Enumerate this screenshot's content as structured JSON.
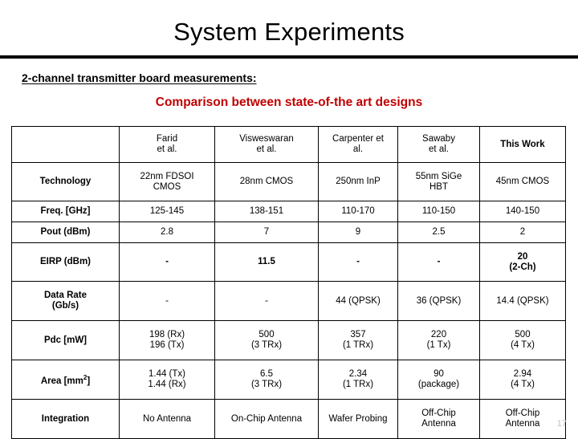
{
  "slide": {
    "title": "System Experiments",
    "subheading": "2-channel transmitter board measurements:",
    "comparison_caption": "Comparison between state-of-the art designs",
    "page_number": "17",
    "accent_red": "#C00000",
    "text_black": "#000000",
    "page_number_color": "#BFBFBF"
  },
  "table": {
    "corner_label": "",
    "columns": [
      {
        "line1": "Farid",
        "line2": "et  al.",
        "strong": false
      },
      {
        "line1": "Visweswaran",
        "line2": "et al.",
        "strong": false
      },
      {
        "line1": "Carpenter et",
        "line2": "al.",
        "strong": false
      },
      {
        "line1": "Sawaby",
        "line2": "et al.",
        "strong": false
      },
      {
        "line1": "This Work",
        "line2": "",
        "strong": true
      }
    ],
    "rows": [
      {
        "label": "Technology",
        "label_sup": "",
        "red": false,
        "cells": [
          {
            "line1": "22nm FDSOI",
            "line2": "CMOS"
          },
          {
            "line1": "28nm CMOS",
            "line2": ""
          },
          {
            "line1": "250nm InP",
            "line2": ""
          },
          {
            "line1": "55nm SiGe",
            "line2": "HBT"
          },
          {
            "line1": "45nm CMOS",
            "line2": ""
          }
        ]
      },
      {
        "label": "Freq. [GHz]",
        "label_sup": "",
        "red": false,
        "cells": [
          {
            "line1": "125-145",
            "line2": ""
          },
          {
            "line1": "138-151",
            "line2": ""
          },
          {
            "line1": "110-170",
            "line2": ""
          },
          {
            "line1": "110-150",
            "line2": ""
          },
          {
            "line1": "140-150",
            "line2": ""
          }
        ]
      },
      {
        "label": "Pout (dBm)",
        "label_sup": "",
        "red": false,
        "cells": [
          {
            "line1": "2.8",
            "line2": ""
          },
          {
            "line1": "7",
            "line2": ""
          },
          {
            "line1": "9",
            "line2": ""
          },
          {
            "line1": "2.5",
            "line2": ""
          },
          {
            "line1": "2",
            "line2": ""
          }
        ]
      },
      {
        "label": "EIRP (dBm)",
        "label_sup": "",
        "red": true,
        "cells": [
          {
            "line1": "-",
            "line2": ""
          },
          {
            "line1": "11.5",
            "line2": ""
          },
          {
            "line1": "-",
            "line2": ""
          },
          {
            "line1": "-",
            "line2": ""
          },
          {
            "line1": "20",
            "line2": "(2-Ch)"
          }
        ]
      },
      {
        "label": "Data Rate",
        "label_line2": "(Gb/s)",
        "label_sup": "",
        "red": false,
        "cells": [
          {
            "line1": "-",
            "line2": ""
          },
          {
            "line1": "-",
            "line2": ""
          },
          {
            "line1": "44 (QPSK)",
            "line2": ""
          },
          {
            "line1": "36 (QPSK)",
            "line2": ""
          },
          {
            "line1": "14.4 (QPSK)",
            "line2": ""
          }
        ]
      },
      {
        "label": "Pdc [mW]",
        "label_sup": "",
        "red": false,
        "cells": [
          {
            "line1": "198 (Rx)",
            "line2": "196 (Tx)"
          },
          {
            "line1": "500",
            "line2": "(3 TRx)"
          },
          {
            "line1": "357",
            "line2": "(1 TRx)"
          },
          {
            "line1": "220",
            "line2": "(1 Tx)"
          },
          {
            "line1": "500",
            "line2": "(4 Tx)"
          }
        ]
      },
      {
        "label": "Area [mm",
        "label_sup": "2",
        "label_suffix": "]",
        "red": false,
        "cells": [
          {
            "line1": "1.44 (Tx)",
            "line2": "1.44 (Rx)"
          },
          {
            "line1": "6.5",
            "line2": "(3 TRx)"
          },
          {
            "line1": "2.34",
            "line2": "(1 TRx)"
          },
          {
            "line1": "90",
            "line2": "(package)"
          },
          {
            "line1": "2.94",
            "line2": "(4 Tx)"
          }
        ]
      },
      {
        "label": "Integration",
        "label_sup": "",
        "red": false,
        "cells": [
          {
            "line1": "No Antenna",
            "line2": ""
          },
          {
            "line1": "On-Chip Antenna",
            "line2": ""
          },
          {
            "line1": "Wafer Probing",
            "line2": ""
          },
          {
            "line1": "Off-Chip",
            "line2": "Antenna"
          },
          {
            "line1": "Off-Chip",
            "line2": "Antenna"
          }
        ]
      }
    ]
  }
}
